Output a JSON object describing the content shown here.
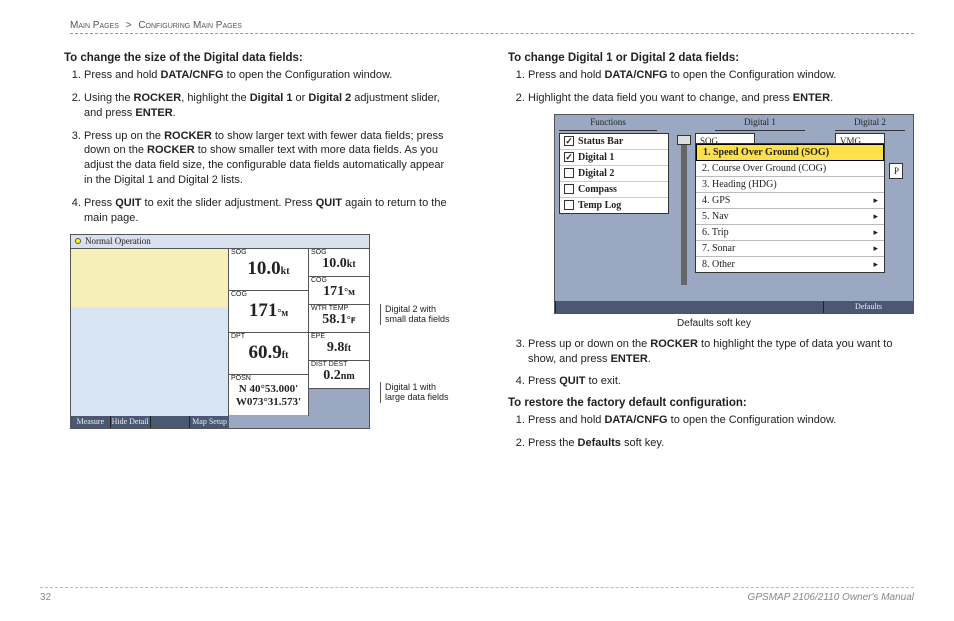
{
  "breadcrumb": {
    "a": "Main Pages",
    "sep": ">",
    "b": "Configuring Main Pages"
  },
  "left": {
    "heading": "To change the size of the Digital data fields:",
    "steps": {
      "s1a": "Press and hold ",
      "s1b": "DATA/CNFG",
      "s1c": " to open the Configuration window.",
      "s2a": "Using the ",
      "s2b": "ROCKER",
      "s2c": ", highlight the ",
      "s2d": "Digital 1",
      "s2e": " or ",
      "s2f": "Digital 2",
      "s2g": " adjustment slider, and press ",
      "s2h": "ENTER",
      "s2i": ".",
      "s3a": "Press up on the ",
      "s3b": "ROCKER",
      "s3c": " to show larger text with fewer data fields; press down on the ",
      "s3d": "ROCKER",
      "s3e": " to show smaller text with more data fields. As you adjust the data field size, the configurable data fields automatically appear in the Digital 1 and Digital 2 lists.",
      "s4a": "Press ",
      "s4b": "QUIT",
      "s4c": " to exit the slider adjustment. Press ",
      "s4d": "QUIT",
      "s4e": " again to return to the main page."
    },
    "fig": {
      "title": "Normal Operation",
      "softkeys": [
        "Measure",
        "Hide Detail",
        "",
        "Map Setup"
      ],
      "c1": {
        "sog": {
          "lbl": "SOG",
          "val": "10.0",
          "unit": "kt"
        },
        "cog": {
          "lbl": "COG",
          "val": "171",
          "unit": "°ᴍ"
        },
        "dpt": {
          "lbl": "DPT",
          "val": "60.9",
          "unit": "ft"
        },
        "posn": {
          "lbl": "POSN",
          "lat": "N  40°53.000'",
          "lon": "W073°31.573'"
        }
      },
      "c2": {
        "sog": {
          "lbl": "SOG",
          "val": "10.0",
          "unit": "kt"
        },
        "cog": {
          "lbl": "COG",
          "val": "171",
          "unit": "°ᴍ"
        },
        "wtr": {
          "lbl": "WTR TEMP",
          "val": "58.1",
          "unit": "°ꜰ"
        },
        "epe": {
          "lbl": "EPE",
          "val": "9.8",
          "unit": "ft"
        },
        "dist": {
          "lbl": "DIST DEST",
          "val": "0.2",
          "unit": "nm"
        }
      },
      "callout_d2": "Digital 2 with small data fields",
      "callout_d1": "Digital 1 with large data fields"
    }
  },
  "right": {
    "heading1": "To change Digital 1 or Digital 2 data fields:",
    "steps1": {
      "s1a": "Press and hold ",
      "s1b": "DATA/CNFG",
      "s1c": " to open the Configuration window.",
      "s2a": "Highlight the data field you want to change, and press ",
      "s2b": "ENTER",
      "s2c": "."
    },
    "fig": {
      "cols": {
        "c1": "Functions",
        "c2": "Digital 1",
        "c3": "Digital 2"
      },
      "panel": [
        "Status Bar",
        "Digital 1",
        "Digital 2",
        "Compass",
        "Temp Log"
      ],
      "checked": [
        true,
        true,
        false,
        false,
        false
      ],
      "sidecells": {
        "sog": "SOG",
        "vmg": "VMG",
        "p": "P"
      },
      "menu": [
        "1. Speed Over Ground (SOG)",
        "2. Course Over Ground (COG)",
        "3. Heading (HDG)",
        "4. GPS",
        "5. Nav",
        "6. Trip",
        "7. Sonar",
        "8. Other"
      ],
      "menu_arrow_from": 3,
      "softkey": "Defaults",
      "caption": "Defaults soft key"
    },
    "steps2": {
      "s3a": "Press up or down on the ",
      "s3b": "ROCKER",
      "s3c": " to highlight the type of data you want to show, and press ",
      "s3d": "ENTER",
      "s3e": ".",
      "s4a": "Press ",
      "s4b": "QUIT",
      "s4c": " to exit."
    },
    "heading2": "To restore the factory default configuration:",
    "steps3": {
      "s1a": "Press and hold ",
      "s1b": "DATA/CNFG",
      "s1c": " to open the Configuration window.",
      "s2a": "Press the ",
      "s2b": "Defaults",
      "s2c": " soft key."
    }
  },
  "footer": {
    "page": "32",
    "title": "GPSMAP 2106/2110 Owner's Manual"
  }
}
